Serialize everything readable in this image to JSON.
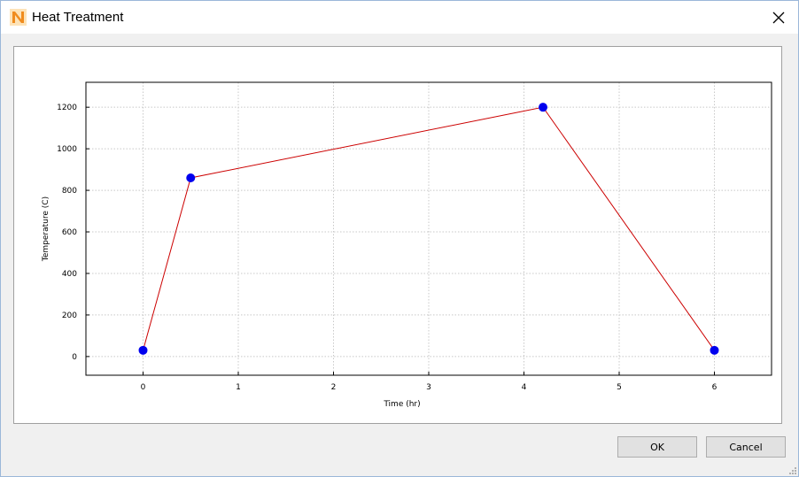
{
  "window": {
    "title": "Heat Treatment",
    "app_icon": "app-logo-n-icon",
    "close_icon": "close-icon"
  },
  "buttons": {
    "ok_label": "OK",
    "cancel_label": "Cancel"
  },
  "colors": {
    "line": "#cc0000",
    "marker": "#0000ee",
    "grid": "#c8c8c8",
    "accent_icon": "#f5a623"
  },
  "chart_data": {
    "type": "line",
    "xlabel": "Time  (hr)",
    "ylabel": "Temperature (C)",
    "xlim": [
      -0.6,
      6.6
    ],
    "ylim": [
      -90,
      1320
    ],
    "x_ticks": [
      "0",
      "1",
      "2",
      "3",
      "4",
      "5",
      "6"
    ],
    "y_ticks": [
      "0",
      "200",
      "400",
      "600",
      "800",
      "1000",
      "1200"
    ],
    "grid": true,
    "series": [
      {
        "x": [
          0,
          0.5,
          4.2,
          6
        ],
        "y": [
          30,
          860,
          1200,
          30
        ]
      }
    ]
  }
}
